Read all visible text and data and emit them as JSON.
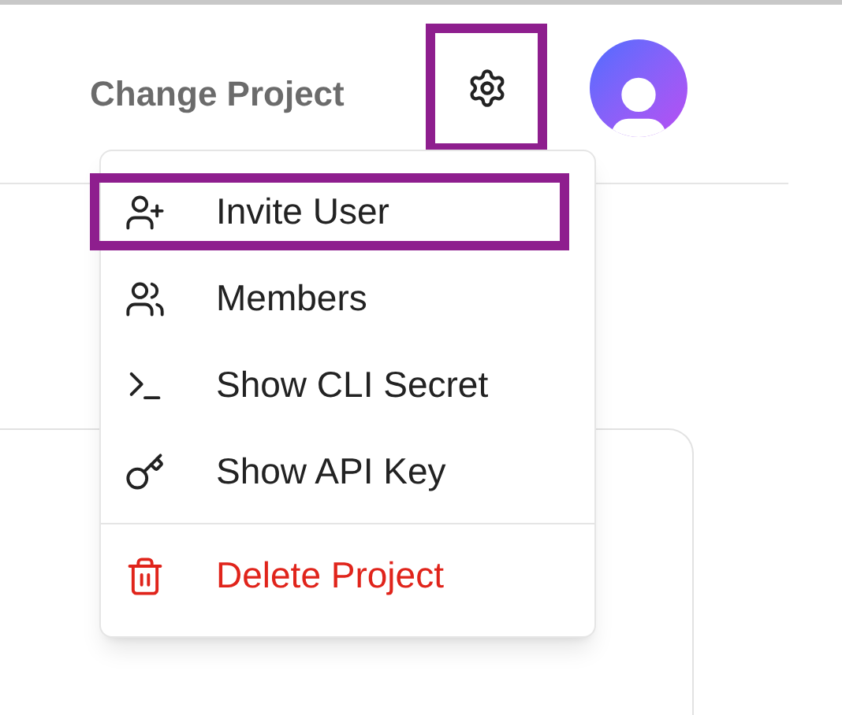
{
  "header": {
    "title": "Change Project",
    "settings_highlighted": true
  },
  "menu": {
    "items": [
      {
        "label": "Invite User",
        "kind": "invite",
        "danger": false,
        "highlighted": true
      },
      {
        "label": "Members",
        "kind": "members",
        "danger": false,
        "highlighted": false
      },
      {
        "label": "Show CLI Secret",
        "kind": "terminal",
        "danger": false,
        "highlighted": false
      },
      {
        "label": "Show API Key",
        "kind": "key",
        "danger": false,
        "highlighted": false
      },
      {
        "label": "Delete Project",
        "kind": "delete",
        "danger": true,
        "highlighted": false
      }
    ]
  }
}
